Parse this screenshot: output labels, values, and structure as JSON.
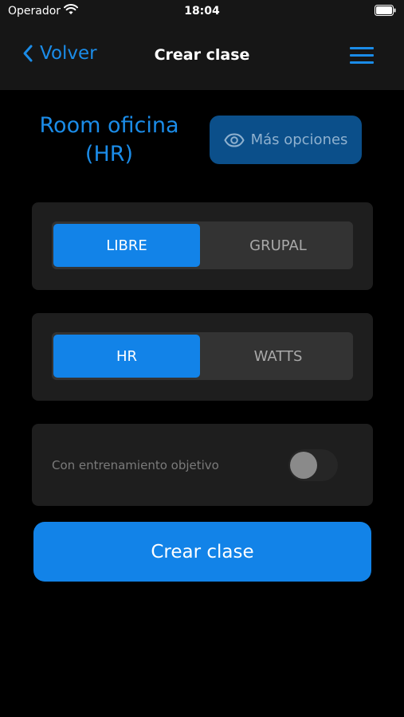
{
  "status_bar": {
    "carrier": "Operador",
    "time": "18:04"
  },
  "nav": {
    "back_label": "Volver",
    "title": "Crear clase"
  },
  "room": {
    "name": "Room oficina",
    "mode": "(HR)"
  },
  "more_options_label": "Más opciones",
  "class_type": {
    "options": [
      "LIBRE",
      "GRUPAL"
    ],
    "selected": "LIBRE"
  },
  "metric": {
    "options": [
      "HR",
      "WATTS"
    ],
    "selected": "HR"
  },
  "objective_training": {
    "label": "Con entrenamiento objetivo",
    "enabled": false
  },
  "create_button_label": "Crear clase",
  "colors": {
    "accent": "#1283e8",
    "background": "#000000",
    "card": "#1e1e1e"
  },
  "icons": [
    "wifi-icon",
    "battery-icon",
    "chevron-left-icon",
    "hamburger-menu-icon",
    "eye-icon"
  ]
}
